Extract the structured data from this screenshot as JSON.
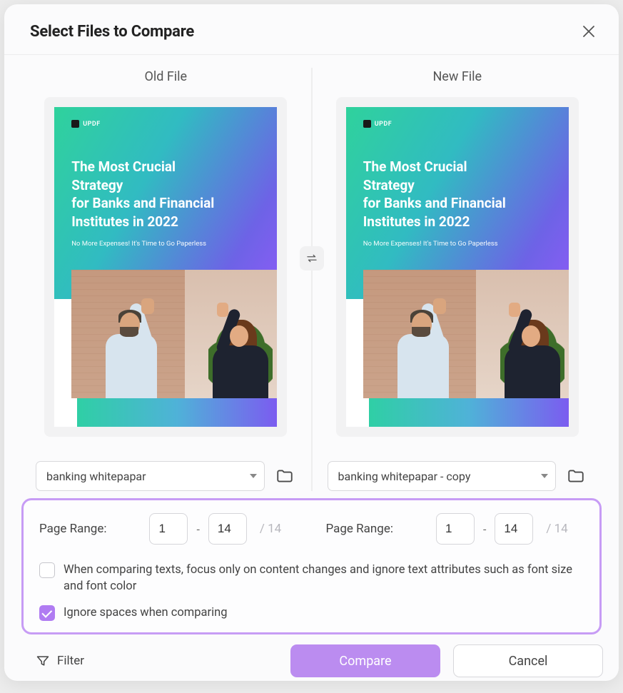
{
  "header": {
    "title": "Select Files to Compare"
  },
  "panes": {
    "old": {
      "heading": "Old File",
      "doc_logo": "UPDF",
      "doc_title_l1": "The Most Crucial Strategy",
      "doc_title_l2": "for Banks and Financial",
      "doc_title_l3": "Institutes in 2022",
      "doc_subtitle": "No More Expenses! It's Time to Go Paperless",
      "file_name": "banking whitepapar"
    },
    "new": {
      "heading": "New File",
      "doc_logo": "UPDF",
      "doc_title_l1": "The Most Crucial Strategy",
      "doc_title_l2": "for Banks and Financial",
      "doc_title_l3": "Institutes in 2022",
      "doc_subtitle": "No More Expenses! It's Time to Go Paperless",
      "file_name": "banking whitepapar - copy"
    }
  },
  "range": {
    "label": "Page Range:",
    "old_from": "1",
    "old_to": "14",
    "old_total": "/  14",
    "new_from": "1",
    "new_to": "14",
    "new_total": "/  14"
  },
  "options": {
    "ignore_attrs_label": "When comparing texts, focus only on content changes and ignore text attributes such as font size and font color",
    "ignore_attrs_checked": false,
    "ignore_spaces_label": "Ignore spaces when comparing",
    "ignore_spaces_checked": true
  },
  "footer": {
    "filter": "Filter",
    "compare": "Compare",
    "cancel": "Cancel"
  }
}
